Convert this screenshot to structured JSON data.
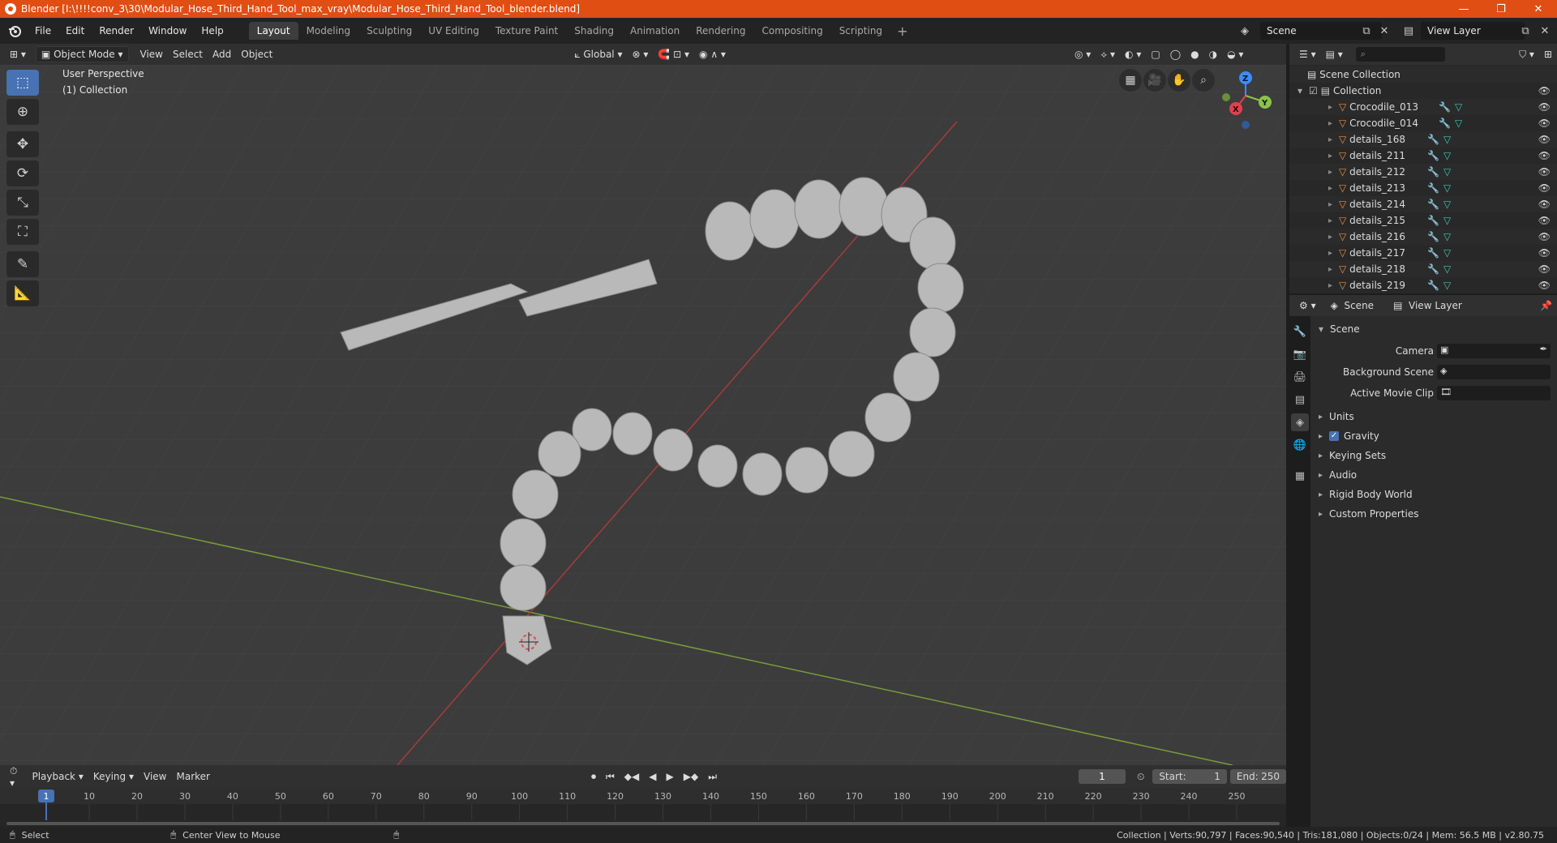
{
  "window": {
    "title": "Blender [I:\\!!!!conv_3\\30\\Modular_Hose_Third_Hand_Tool_max_vray\\Modular_Hose_Third_Hand_Tool_blender.blend]",
    "minimize": "—",
    "maximize": "❐",
    "close": "✕"
  },
  "menu": [
    "File",
    "Edit",
    "Render",
    "Window",
    "Help"
  ],
  "workspaces": [
    "Layout",
    "Modeling",
    "Sculpting",
    "UV Editing",
    "Texture Paint",
    "Shading",
    "Animation",
    "Rendering",
    "Compositing",
    "Scripting"
  ],
  "workspace_add": "+",
  "scene": {
    "name": "Scene",
    "view_layer": "View Layer"
  },
  "viewport_header": {
    "mode": "Object Mode",
    "menus": [
      "View",
      "Select",
      "Add",
      "Object"
    ],
    "transform_orientation": "Global"
  },
  "viewport": {
    "perspective_label": "User Perspective",
    "collection_label": "(1) Collection",
    "gizmo": {
      "x": "X",
      "y": "Y",
      "z": "Z"
    }
  },
  "outliner": {
    "root": "Scene Collection",
    "collection": "Collection",
    "items": [
      "Crocodile_013",
      "Crocodile_014",
      "details_168",
      "details_211",
      "details_212",
      "details_213",
      "details_214",
      "details_215",
      "details_216",
      "details_217",
      "details_218",
      "details_219"
    ]
  },
  "properties": {
    "tabs": {
      "scene": "Scene",
      "view_layer": "View Layer"
    },
    "section": "Scene",
    "fields": [
      {
        "label": "Camera"
      },
      {
        "label": "Background Scene"
      },
      {
        "label": "Active Movie Clip"
      }
    ],
    "panels": [
      "Units",
      "Gravity",
      "Keying Sets",
      "Audio",
      "Rigid Body World",
      "Custom Properties"
    ]
  },
  "timeline": {
    "menus": [
      "Playback",
      "Keying",
      "View",
      "Marker"
    ],
    "current_frame": "1",
    "start_label": "Start:",
    "start": "1",
    "end_label": "End:",
    "end": "250",
    "ticks": [
      "1",
      "10",
      "20",
      "30",
      "40",
      "50",
      "60",
      "70",
      "80",
      "90",
      "100",
      "110",
      "120",
      "130",
      "140",
      "150",
      "160",
      "170",
      "180",
      "190",
      "200",
      "210",
      "220",
      "230",
      "240",
      "250"
    ]
  },
  "statusbar": {
    "left": "Select",
    "middle": "Center View to Mouse",
    "right": "Collection | Verts:90,797 | Faces:90,540 | Tris:181,080 | Objects:0/24 | Mem: 56.5 MB | v2.80.75"
  },
  "colors": {
    "titlebar": "#e04e13",
    "accent": "#4772b3",
    "x_axis": "#e0414f",
    "y_axis": "#8bc34a",
    "z_axis": "#3d8bff"
  }
}
